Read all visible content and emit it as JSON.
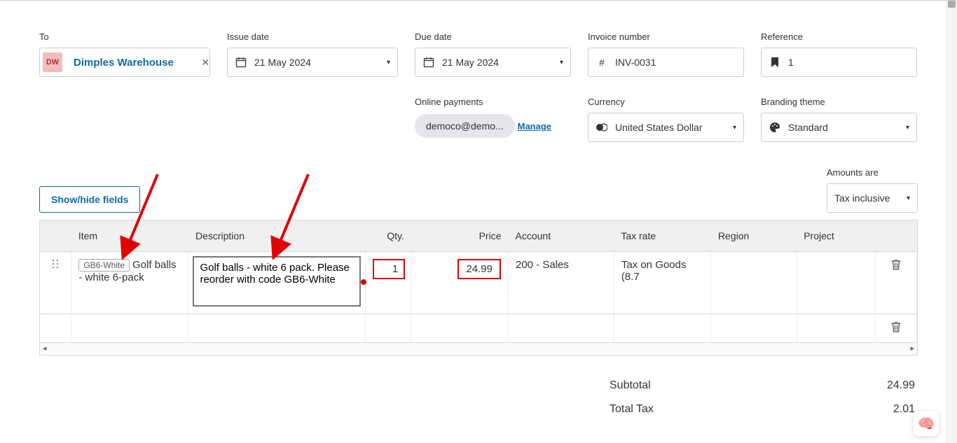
{
  "header": {
    "to_label": "To",
    "to_chip": "DW",
    "to_name": "Dimples Warehouse",
    "issue_label": "Issue date",
    "issue_value": "21 May 2024",
    "due_label": "Due date",
    "due_value": "21 May 2024",
    "invno_label": "Invoice number",
    "invno_value": "INV-0031",
    "ref_label": "Reference",
    "ref_value": "1"
  },
  "row2": {
    "online_label": "Online payments",
    "online_pill": "democo@demo...",
    "manage": "Manage",
    "currency_label": "Currency",
    "currency_value": "United States Dollar",
    "brand_label": "Branding theme",
    "brand_value": "Standard"
  },
  "toolbar": {
    "show_hide": "Show/hide fields",
    "amounts_label": "Amounts are",
    "tax_value": "Tax inclusive"
  },
  "columns": {
    "item": "Item",
    "desc": "Description",
    "qty": "Qty.",
    "price": "Price",
    "account": "Account",
    "tax": "Tax rate",
    "region": "Region",
    "project": "Project"
  },
  "line": {
    "code": "GB6-White",
    "item_text": "Golf balls - white 6-pack",
    "desc": "Golf balls - white 6 pack. Please reorder with code GB6-White",
    "qty": "1",
    "price": "24.99",
    "account": "200 - Sales",
    "tax": "Tax on Goods (8.7"
  },
  "totals": {
    "subtotal_label": "Subtotal",
    "subtotal_value": "24.99",
    "tax_label": "Total Tax",
    "tax_value": "2.01"
  }
}
